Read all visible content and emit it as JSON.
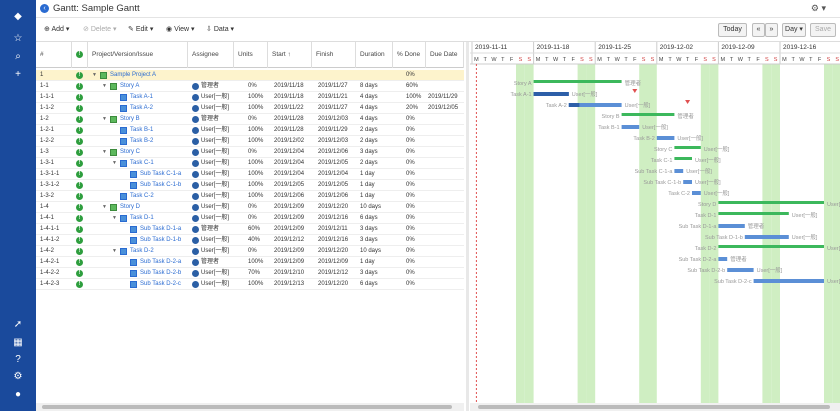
{
  "title": "Gantt: Sample Gantt",
  "toolbar": {
    "add": "Add",
    "delete": "Delete",
    "edit": "Edit",
    "view": "View",
    "data": "Data",
    "today": "Today",
    "prev": "«",
    "next": "»",
    "scale": "Day",
    "save": "Save"
  },
  "columns": [
    "#",
    "",
    "Project/Version/Issue",
    "Assignee",
    "Units",
    "Start",
    "Finish",
    "Duration",
    "% Done",
    "Due Date"
  ],
  "sort_indicator": "↑",
  "weeks": [
    "2019-11-11",
    "2019-11-18",
    "2019-11-25",
    "2019-12-02",
    "2019-12-09",
    "2019-12-16"
  ],
  "day_letters": [
    "M",
    "T",
    "W",
    "T",
    "F",
    "S",
    "S"
  ],
  "rows": [
    {
      "id": "1",
      "level": 0,
      "kind": "project",
      "name": "Sample Project A",
      "assignee": "",
      "units": "",
      "start": "",
      "finish": "",
      "duration": "",
      "done": "0%",
      "due": "",
      "sel": true
    },
    {
      "id": "1-1",
      "level": 1,
      "kind": "story",
      "name": "Story A",
      "assignee": "管理者",
      "units": "0%",
      "start": "2019/11/18",
      "finish": "2019/11/27",
      "duration": "8 days",
      "done": "60%",
      "due": ""
    },
    {
      "id": "1-1-1",
      "level": 2,
      "kind": "task",
      "name": "Task A-1",
      "assignee": "User[一般]",
      "units": "100%",
      "start": "2019/11/18",
      "finish": "2019/11/21",
      "duration": "4 days",
      "done": "100%",
      "due": "2019/11/29"
    },
    {
      "id": "1-1-2",
      "level": 2,
      "kind": "task",
      "name": "Task A-2",
      "assignee": "User[一般]",
      "units": "100%",
      "start": "2019/11/22",
      "finish": "2019/11/27",
      "duration": "4 days",
      "done": "20%",
      "due": "2019/12/05"
    },
    {
      "id": "1-2",
      "level": 1,
      "kind": "story",
      "name": "Story B",
      "assignee": "管理者",
      "units": "0%",
      "start": "2019/11/28",
      "finish": "2019/12/03",
      "duration": "4 days",
      "done": "0%",
      "due": ""
    },
    {
      "id": "1-2-1",
      "level": 2,
      "kind": "task",
      "name": "Task B-1",
      "assignee": "User[一般]",
      "units": "100%",
      "start": "2019/11/28",
      "finish": "2019/11/29",
      "duration": "2 days",
      "done": "0%",
      "due": ""
    },
    {
      "id": "1-2-2",
      "level": 2,
      "kind": "task",
      "name": "Task B-2",
      "assignee": "User[一般]",
      "units": "100%",
      "start": "2019/12/02",
      "finish": "2019/12/03",
      "duration": "2 days",
      "done": "0%",
      "due": ""
    },
    {
      "id": "1-3",
      "level": 1,
      "kind": "story",
      "name": "Story C",
      "assignee": "User[一般]",
      "units": "0%",
      "start": "2019/12/04",
      "finish": "2019/12/06",
      "duration": "3 days",
      "done": "0%",
      "due": ""
    },
    {
      "id": "1-3-1",
      "level": 2,
      "kind": "task",
      "name": "Task C-1",
      "assignee": "User[一般]",
      "units": "100%",
      "start": "2019/12/04",
      "finish": "2019/12/05",
      "duration": "2 days",
      "done": "0%",
      "due": ""
    },
    {
      "id": "1-3-1-1",
      "level": 3,
      "kind": "sub",
      "name": "Sub Task C-1-a",
      "assignee": "User[一般]",
      "units": "100%",
      "start": "2019/12/04",
      "finish": "2019/12/04",
      "duration": "1 day",
      "done": "0%",
      "due": ""
    },
    {
      "id": "1-3-1-2",
      "level": 3,
      "kind": "sub",
      "name": "Sub Task C-1-b",
      "assignee": "User[一般]",
      "units": "100%",
      "start": "2019/12/05",
      "finish": "2019/12/05",
      "duration": "1 day",
      "done": "0%",
      "due": ""
    },
    {
      "id": "1-3-2",
      "level": 2,
      "kind": "task",
      "name": "Task C-2",
      "assignee": "User[一般]",
      "units": "100%",
      "start": "2019/12/06",
      "finish": "2019/12/06",
      "duration": "1 day",
      "done": "0%",
      "due": ""
    },
    {
      "id": "1-4",
      "level": 1,
      "kind": "story",
      "name": "Story D",
      "assignee": "User[一般]",
      "units": "0%",
      "start": "2019/12/09",
      "finish": "2019/12/20",
      "duration": "10 days",
      "done": "0%",
      "due": ""
    },
    {
      "id": "1-4-1",
      "level": 2,
      "kind": "task",
      "name": "Task D-1",
      "assignee": "User[一般]",
      "units": "0%",
      "start": "2019/12/09",
      "finish": "2019/12/16",
      "duration": "6 days",
      "done": "0%",
      "due": ""
    },
    {
      "id": "1-4-1-1",
      "level": 3,
      "kind": "sub",
      "name": "Sub Task D-1-a",
      "assignee": "管理者",
      "units": "60%",
      "start": "2019/12/09",
      "finish": "2019/12/11",
      "duration": "3 days",
      "done": "0%",
      "due": ""
    },
    {
      "id": "1-4-1-2",
      "level": 3,
      "kind": "sub",
      "name": "Sub Task D-1-b",
      "assignee": "User[一般]",
      "units": "40%",
      "start": "2019/12/12",
      "finish": "2019/12/16",
      "duration": "3 days",
      "done": "0%",
      "due": ""
    },
    {
      "id": "1-4-2",
      "level": 2,
      "kind": "task",
      "name": "Task D-2",
      "assignee": "User[一般]",
      "units": "0%",
      "start": "2019/12/09",
      "finish": "2019/12/20",
      "duration": "10 days",
      "done": "0%",
      "due": ""
    },
    {
      "id": "1-4-2-1",
      "level": 3,
      "kind": "sub",
      "name": "Sub Task D-2-a",
      "assignee": "管理者",
      "units": "100%",
      "start": "2019/12/09",
      "finish": "2019/12/09",
      "duration": "1 day",
      "done": "0%",
      "due": ""
    },
    {
      "id": "1-4-2-2",
      "level": 3,
      "kind": "sub",
      "name": "Sub Task D-2-b",
      "assignee": "User[一般]",
      "units": "70%",
      "start": "2019/12/10",
      "finish": "2019/12/12",
      "duration": "3 days",
      "done": "0%",
      "due": ""
    },
    {
      "id": "1-4-2-3",
      "level": 3,
      "kind": "sub",
      "name": "Sub Task D-2-c",
      "assignee": "User[一般]",
      "units": "100%",
      "start": "2019/12/13",
      "finish": "2019/12/20",
      "duration": "6 days",
      "done": "0%",
      "due": ""
    }
  ],
  "colors": {
    "nav": "#1a4a9c",
    "story_bar": "#3cb85c",
    "task_bar": "#5b8fd6",
    "weekend": "#cfeec2",
    "today": "#e05050"
  }
}
